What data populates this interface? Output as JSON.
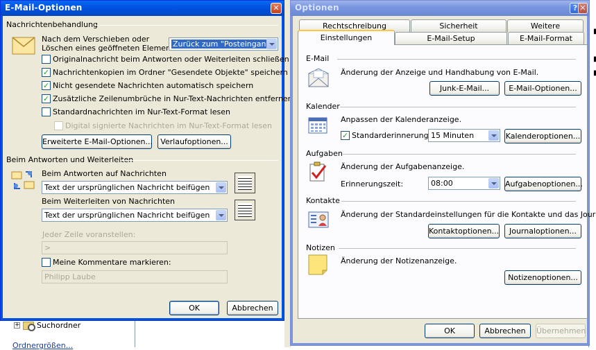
{
  "background": {
    "folder_label": "Suchordner",
    "footer_text": "Ordnergrößen..."
  },
  "mail_dialog": {
    "title": "E-Mail-Optionen",
    "section1": "Nachrichtenbehandlung",
    "move_label_line1": "Nach dem Verschieben oder",
    "move_label_line2": "Löschen eines geöffneten Elements:",
    "move_select": "Zurück zum \"Posteingang\"",
    "options": [
      {
        "label": "Originalnachricht beim Antworten oder Weiterleiten schließen",
        "checked": false
      },
      {
        "label": "Nachrichtenkopien im Ordner \"Gesendete Objekte\" speichern",
        "checked": true
      },
      {
        "label": "Nicht gesendete Nachrichten automatisch speichern",
        "checked": true
      },
      {
        "label": "Zusätzliche Zeilenumbrüche in Nur-Text-Nachrichten entfernen",
        "checked": true
      },
      {
        "label": "Standardnachrichten im Nur-Text-Format lesen",
        "checked": false
      },
      {
        "label": "Digital signierte Nachrichten im Nur-Text-Format lesen",
        "checked": false
      }
    ],
    "btn_advanced": "Erweiterte E-Mail-Optionen...",
    "btn_tracking": "Verlaufoptionen...",
    "section2": "Beim Antworten und Weiterleiten",
    "reply_label": "Beim Antworten auf Nachrichten",
    "reply_select": "Text der ursprünglichen Nachricht beifügen",
    "forward_label": "Beim Weiterleiten von Nachrichten",
    "forward_select": "Text der ursprünglichen Nachricht beifügen",
    "prefix_label": "Jeder Zeile voranstellen:",
    "prefix_value": ">",
    "mark_label": "Meine Kommentare markieren:",
    "mark_value": "Philipp Laube",
    "btn_ok": "OK",
    "btn_cancel": "Abbrechen"
  },
  "options_dialog": {
    "title": "Optionen",
    "tabs_back": [
      "Rechtschreibung",
      "Sicherheit",
      "Weitere"
    ],
    "tabs_front": [
      "Einstellungen",
      "E-Mail-Setup",
      "E-Mail-Format"
    ],
    "email": {
      "title": "E-Mail",
      "desc": "Änderung der Anzeige und Handhabung von E-Mail.",
      "btn_junk": "Junk-E-Mail...",
      "btn_options": "E-Mail-Optionen..."
    },
    "calendar": {
      "title": "Kalender",
      "desc": "Anpassen der Kalenderanzeige.",
      "reminder_label": "Standarderinnerung:",
      "reminder_value": "15 Minuten",
      "btn_options": "Kalenderoptionen..."
    },
    "tasks": {
      "title": "Aufgaben",
      "desc": "Änderung der Aufgabenanzeige.",
      "time_label": "Erinnerungszeit:",
      "time_value": "08:00",
      "btn_options": "Aufgabenoptionen..."
    },
    "contacts": {
      "title": "Kontakte",
      "desc": "Änderung der Standardeinstellungen für die Kontakte und das Journal.",
      "btn_contacts": "Kontaktoptionen...",
      "btn_journal": "Journaloptionen..."
    },
    "notes": {
      "title": "Notizen",
      "desc": "Änderung der Notizenanzeige.",
      "btn_options": "Notizenoptionen..."
    },
    "btn_ok": "OK",
    "btn_cancel": "Abbrechen",
    "btn_apply": "Übernehmen"
  }
}
